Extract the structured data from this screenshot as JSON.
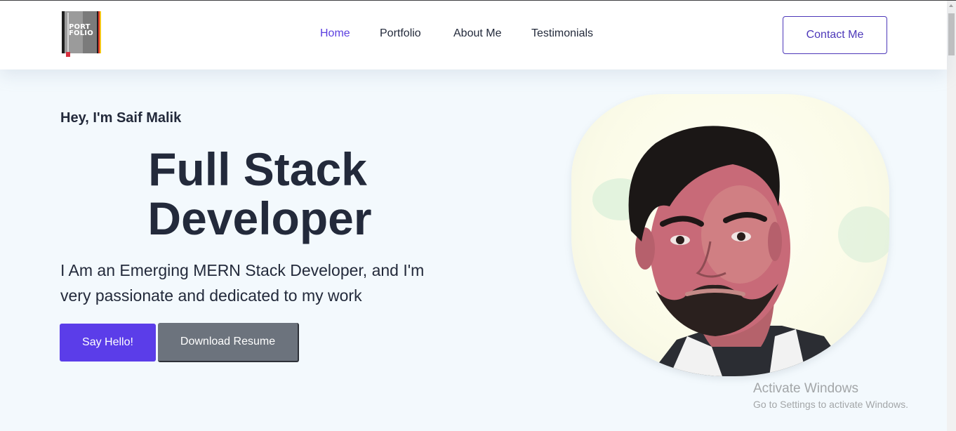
{
  "header": {
    "logo_text_line1": "PORT",
    "logo_text_line2": "FOLIO",
    "nav": [
      {
        "label": "Home",
        "active": true
      },
      {
        "label": "Portfolio",
        "active": false
      },
      {
        "label": "About Me",
        "active": false
      },
      {
        "label": "Testimonials",
        "active": false
      }
    ],
    "contact_label": "Contact Me"
  },
  "hero": {
    "greeting": "Hey, I'm Saif Malik",
    "headline_line1": "Full Stack",
    "headline_line2": "Developer",
    "subtitle": "I Am an Emerging MERN Stack Developer, and I'm very passionate and dedicated to my work",
    "primary_button": "Say Hello!",
    "secondary_button": "Download Resume"
  },
  "watermark": {
    "title": "Activate Windows",
    "subtitle": "Go to Settings to activate Windows."
  },
  "colors": {
    "accent": "#5b3de9",
    "text_dark": "#232a3b",
    "secondary_button": "#6c737d",
    "background": "#f3f9fd"
  }
}
